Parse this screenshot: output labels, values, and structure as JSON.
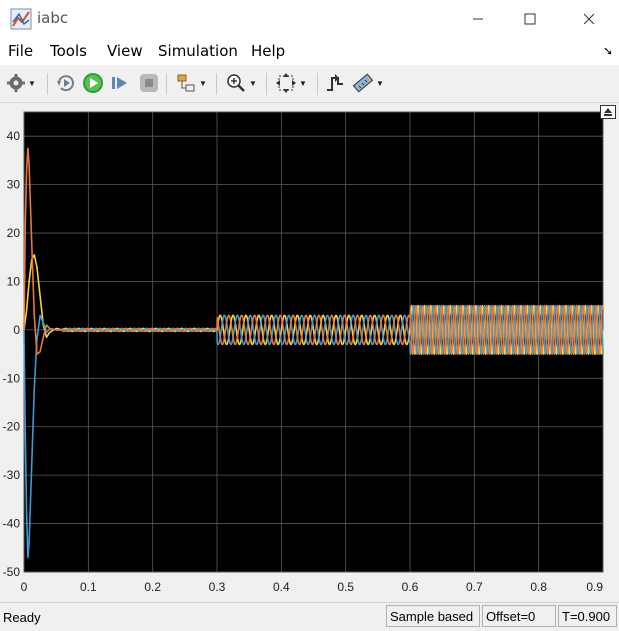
{
  "window": {
    "title": "iabc",
    "app_icon": "matlab-scope-icon",
    "controls": {
      "minimize": "–",
      "maximize": "☐",
      "close": "✕"
    }
  },
  "menu": {
    "items": [
      "File",
      "Tools",
      "View",
      "Simulation",
      "Help"
    ],
    "pin_glyph": "➘"
  },
  "toolbar": {
    "icons": [
      "settings-gear-icon",
      "step-back-icon",
      "run-icon",
      "step-forward-icon",
      "stop-icon",
      "highlight-block-icon",
      "zoom-in-icon",
      "autoscale-icon",
      "triggers-icon",
      "measurements-icon"
    ]
  },
  "colors": {
    "plot_background": "#000000",
    "axes_text": "#d9d9d9",
    "grid": "#5a5a5a",
    "series": [
      "#f5d43b",
      "#3b9ad8",
      "#e8793a"
    ]
  },
  "chart_data": {
    "type": "line",
    "title": "",
    "xlabel": "",
    "ylabel": "",
    "xlim": [
      0,
      0.9
    ],
    "ylim": [
      -50,
      45
    ],
    "xticks": [
      "0",
      "0.1",
      "0.2",
      "0.3",
      "0.4",
      "0.5",
      "0.6",
      "0.7",
      "0.8",
      "0.9"
    ],
    "yticks": [
      "40",
      "30",
      "20",
      "10",
      "0",
      "-10",
      "-20",
      "-30",
      "-40",
      "-50"
    ],
    "ytick_values": [
      40,
      30,
      20,
      10,
      0,
      -10,
      -20,
      -30,
      -40,
      -50
    ],
    "xtick_values": [
      0,
      0.1,
      0.2,
      0.3,
      0.4,
      0.5,
      0.6,
      0.7,
      0.8,
      0.9
    ],
    "grid": true,
    "series": [
      {
        "color": "#f5d43b",
        "transient_x": [
          0,
          0.004,
          0.008,
          0.012,
          0.016,
          0.02,
          0.025,
          0.03,
          0.035,
          0.04,
          0.05,
          0.06
        ],
        "transient_y": [
          0,
          4,
          10,
          14.5,
          15.5,
          13,
          7,
          1,
          -1.5,
          -0.5,
          0.3,
          0
        ]
      },
      {
        "color": "#3b9ad8",
        "transient_x": [
          0,
          0.002,
          0.004,
          0.006,
          0.008,
          0.012,
          0.016,
          0.02,
          0.025,
          0.03,
          0.035,
          0.04,
          0.05,
          0.06
        ],
        "transient_y": [
          0,
          -22,
          -38,
          -47,
          -44,
          -28,
          -12,
          -2,
          3,
          1.5,
          -0.5,
          0.2,
          0,
          0
        ]
      },
      {
        "color": "#e8793a",
        "transient_x": [
          0,
          0.002,
          0.004,
          0.006,
          0.008,
          0.012,
          0.016,
          0.02,
          0.025,
          0.03,
          0.035,
          0.04,
          0.05,
          0.06
        ],
        "transient_y": [
          0,
          22,
          33,
          37.5,
          34,
          18,
          3,
          -5,
          -4.5,
          -1.5,
          1,
          0.3,
          0,
          0
        ]
      }
    ],
    "segments": [
      {
        "x_start": 0.06,
        "x_end": 0.3,
        "amplitude": 0.3,
        "frequency_hz": 50
      },
      {
        "x_start": 0.3,
        "x_end": 0.6,
        "amplitude": 3,
        "frequency_hz": 50
      },
      {
        "x_start": 0.6,
        "x_end": 0.9,
        "amplitude": 5,
        "frequency_hz": 100
      }
    ]
  },
  "status": {
    "ready": "Ready",
    "sample": "Sample based",
    "offset": "Offset=0",
    "time": "T=0.900"
  }
}
